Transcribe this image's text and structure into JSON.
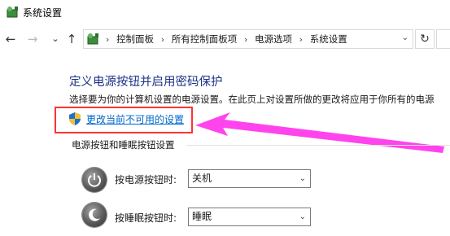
{
  "window": {
    "title": "系统设置"
  },
  "nav": {
    "back_glyph": "←",
    "forward_glyph": "→",
    "recent_glyph": "⌄",
    "up_glyph": "↑",
    "refresh_glyph": "↻",
    "breadcrumb_sep": "›",
    "breadcrumbs": [
      "控制面板",
      "所有控制面板项",
      "电源选项",
      "系统设置"
    ]
  },
  "main": {
    "heading": "定义电源按钮并启用密码保护",
    "description": "选择要为你的计算机设置的电源设置。在此页上对设置所做的更改将应用于你所有的电源",
    "change_link": "更改当前不可用的设置",
    "section_title": "电源按钮和睡眠按钮设置",
    "rows": [
      {
        "label": "按电源按钮时:",
        "value": "关机",
        "icon": "power-icon"
      },
      {
        "label": "按睡眠按钮时:",
        "value": "睡眠",
        "icon": "sleep-icon"
      }
    ]
  },
  "colors": {
    "heading": "#1e3287",
    "link": "#0066cc",
    "highlight_box": "#ff3333",
    "arrow": "#ff44ee"
  }
}
